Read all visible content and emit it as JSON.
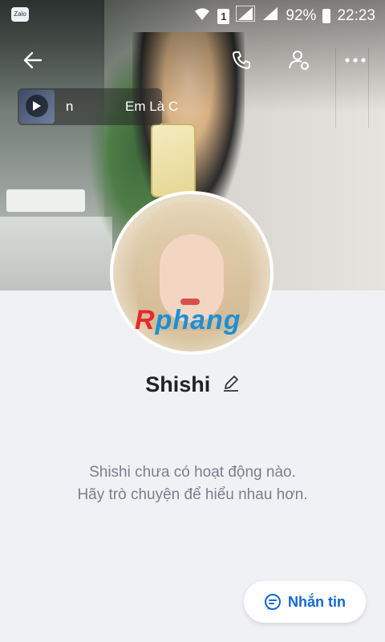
{
  "status_bar": {
    "app_label": "Zalo",
    "sim_slot": "1",
    "battery": "92%",
    "time": "22:23"
  },
  "cover": {
    "music_title": "n",
    "music_title_2": "Em Là C"
  },
  "profile": {
    "name": "Shishi",
    "watermark_first": "R",
    "watermark_rest": "phang"
  },
  "empty_state": {
    "line1": "Shishi chưa có hoạt động nào.",
    "line2": "Hãy trò chuyện để hiểu nhau hơn."
  },
  "actions": {
    "message_label": "Nhắn tin"
  },
  "colors": {
    "accent": "#1267d8",
    "background": "#f0f1f5"
  },
  "icons": {
    "back": "back-arrow-icon",
    "call": "phone-icon",
    "user_settings": "user-settings-icon",
    "more": "more-icon",
    "edit": "pencil-icon",
    "message": "chat-bubble-icon"
  }
}
